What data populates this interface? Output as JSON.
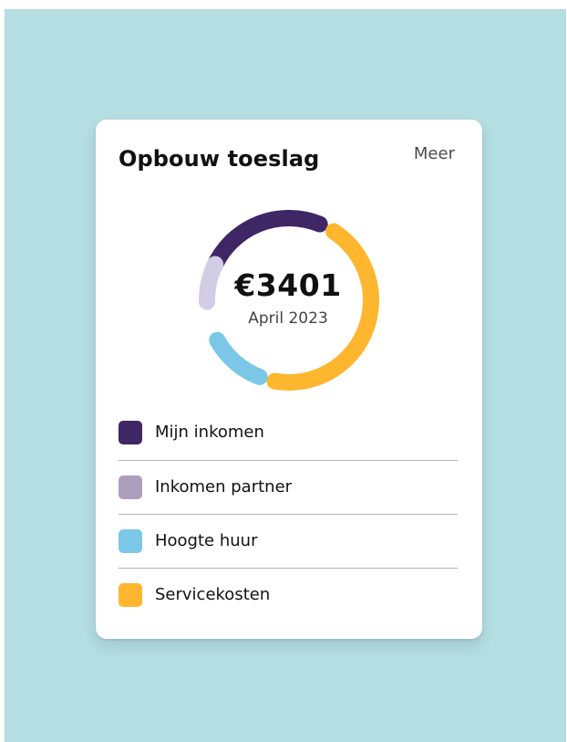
{
  "card": {
    "title": "Opbouw toeslag",
    "more_label": "Meer"
  },
  "summary": {
    "amount": "€3401",
    "period": "April 2023"
  },
  "legend": [
    {
      "label": "Mijn inkomen",
      "color": "#3f2766"
    },
    {
      "label": "Inkomen partner",
      "color": "#ae9ebe"
    },
    {
      "label": "Hoogte huur",
      "color": "#7cc7e7"
    },
    {
      "label": "Servicekosten",
      "color": "#ffb62f"
    }
  ],
  "donut": {
    "segments": [
      {
        "name": "Mijn inkomen",
        "color": "#3f2766"
      },
      {
        "name": "Servicekosten",
        "color": "#ffb62f"
      },
      {
        "name": "Hoogte huur",
        "color": "#7cc7e7"
      },
      {
        "name": "Inkomen partner",
        "color": "#d2cde4"
      }
    ]
  }
}
